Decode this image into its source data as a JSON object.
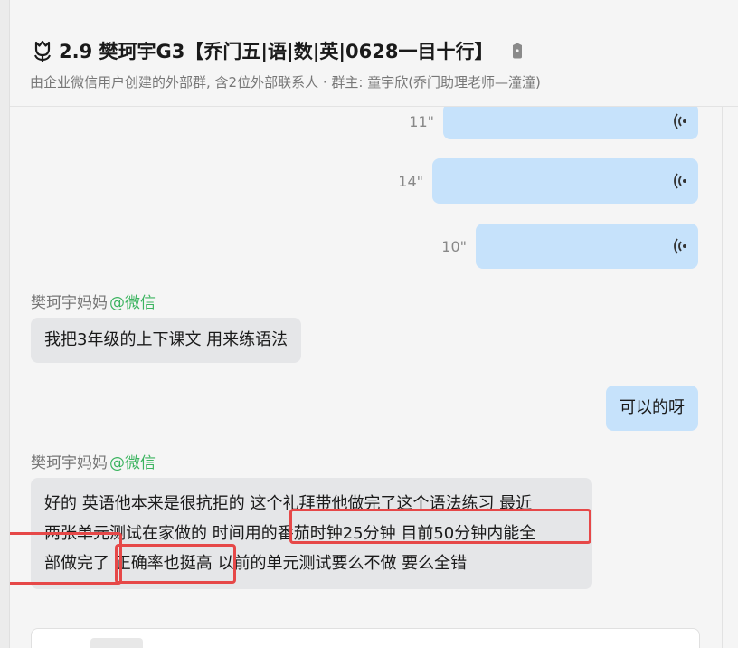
{
  "header": {
    "title": "2.9 樊珂宇G3【乔门五|语|数|英|0628一目十行】",
    "subtitle": "由企业微信用户创建的外部群, 含2位外部联系人 · 群主: 童宇欣(乔门助理老师—潼潼)"
  },
  "icons": {
    "group": "tulip-icon",
    "lock": "lock-icon",
    "voice": "voice-wave-icon"
  },
  "messages": {
    "voice1": {
      "duration": "11\""
    },
    "voice2": {
      "duration": "14\""
    },
    "voice3": {
      "duration": "10\""
    },
    "msg1": {
      "sender": "樊珂宇妈妈",
      "sender_tag": "@微信",
      "text": "我把3年级的上下课文 用来练语法"
    },
    "reply1": {
      "text": "可以的呀"
    },
    "msg2": {
      "sender": "樊珂宇妈妈",
      "sender_tag": "@微信",
      "line1": "好的 英语他本来是很抗拒的 这个礼拜带他做完了这个语法练习 最近",
      "line2": "两张单元测试在家做的 时间用的番茄时钟25分钟 目前50分钟内能全",
      "line3": "部做完了 正确率也挺高 以前的单元测试要么不做 要么全错"
    }
  },
  "colors": {
    "outgoing_bubble": "#c6e2fb",
    "incoming_bubble": "#e5e6e8",
    "wechat_tag": "#3cb460",
    "annotation": "#e64848"
  }
}
